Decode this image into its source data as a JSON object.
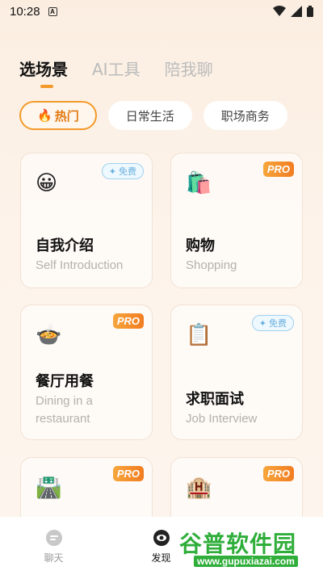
{
  "status_bar": {
    "time": "10:28",
    "sim_label": "A"
  },
  "top_tabs": [
    {
      "label": "选场景"
    },
    {
      "label": "AI工具"
    },
    {
      "label": "陪我聊"
    }
  ],
  "chips": [
    {
      "label": "热门",
      "icon": "fire-icon"
    },
    {
      "label": "日常生活"
    },
    {
      "label": "职场商务"
    }
  ],
  "cards": [
    {
      "emoji": "😀",
      "title": "自我介绍",
      "subtitle": "Self Introduction",
      "badge": "免费"
    },
    {
      "emoji": "🛍️",
      "title": "购物",
      "subtitle": "Shopping",
      "badge": "PRO"
    },
    {
      "emoji": "🍲",
      "title": "餐厅用餐",
      "subtitle": "Dining in a restaurant",
      "badge": "PRO"
    },
    {
      "emoji": "📋",
      "title": "求职面试",
      "subtitle": "Job Interview",
      "badge": "免费"
    },
    {
      "emoji": "🛣️",
      "badge": "PRO"
    },
    {
      "emoji": "🏨",
      "badge": "PRO"
    }
  ],
  "bottom_nav": [
    {
      "label": "聊天",
      "icon": "chat-icon"
    },
    {
      "label": "发现",
      "icon": "discover-icon"
    }
  ],
  "watermark": {
    "title": "谷普软件园",
    "url": "www.gupuxiazai.com"
  },
  "colors": {
    "accent": "#f39a2a",
    "pro_badge": "#f17c21",
    "free_badge": "#6ab0dc"
  }
}
